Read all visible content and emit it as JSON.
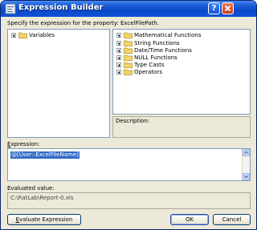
{
  "window": {
    "title": "Expression Builder",
    "help_label": "?",
    "close_label": "close"
  },
  "instruction": "Specify the expression for the property: ExcelFilePath.",
  "variables_tree": [
    {
      "label": "Variables"
    }
  ],
  "functions_tree": [
    {
      "label": "Mathematical Functions"
    },
    {
      "label": "String Functions"
    },
    {
      "label": "Date/Time Functions"
    },
    {
      "label": "NULL Functions"
    },
    {
      "label": "Type Casts"
    },
    {
      "label": "Operators"
    }
  ],
  "description": {
    "label": "Description:"
  },
  "expression": {
    "label_first": "E",
    "label_rest": "xpression:",
    "value": "@[User::ExcelFileName]"
  },
  "evaluated": {
    "label": "Evaluated value:",
    "value": "C:\\RatLab\\Report-0.xls"
  },
  "buttons": {
    "evaluate_first": "E",
    "evaluate_rest": "valuate Expression",
    "ok": "OK",
    "cancel": "Cancel"
  },
  "colors": {
    "selection": "#316ac5",
    "titlebar": "#0b49c9",
    "folder": "#f3d46b"
  }
}
